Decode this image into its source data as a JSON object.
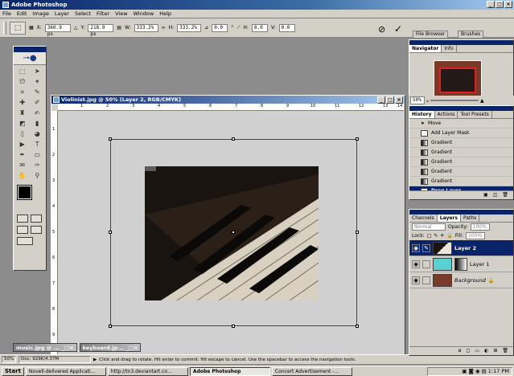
{
  "app": {
    "title": "Adobe Photoshop",
    "window_buttons": [
      "_",
      "□",
      "×"
    ]
  },
  "menu": [
    "File",
    "Edit",
    "Image",
    "Layer",
    "Select",
    "Filter",
    "View",
    "Window",
    "Help"
  ],
  "options_bar": {
    "preset_icon": "transform-icon",
    "x_label": "X:",
    "x_value": "360.9 px",
    "y_label": "Y:",
    "y_value": "218.9 px",
    "w_label": "W:",
    "w_value": "333.2%",
    "h_label": "H:",
    "h_value": "333.2%",
    "angle_value": "0.0",
    "angle_unit": "°",
    "hskew_label": "H:",
    "hskew_value": "0.0",
    "vskew_label": "V:",
    "vskew_value": "0.0",
    "cancel_symbol": "⊘",
    "commit_symbol": "✓"
  },
  "palette_well": {
    "tabs": [
      "File Browser",
      "Brushes"
    ]
  },
  "document": {
    "title": "Violinist.jpg @ 50% (Layer 2, RGB/CMYK)",
    "ruler_h": [
      "1",
      "2",
      "3",
      "4",
      "5",
      "6",
      "7",
      "8",
      "9",
      "10",
      "11",
      "12",
      "13",
      "14"
    ],
    "ruler_v": [
      "1",
      "2",
      "3",
      "4",
      "5",
      "6",
      "7",
      "8",
      "9"
    ],
    "photo_colors": {
      "dark": "#1a1410",
      "key_white": "#ece6d8",
      "key_black": "#0c0a08"
    }
  },
  "mini_docs": [
    {
      "label": "music.jpg @ ...",
      "buttons": "_□×"
    },
    {
      "label": "keyboard.jp...",
      "buttons": "_□×"
    }
  ],
  "status": {
    "zoom": "50%",
    "doc_info": "Doc: 929K/4.37M",
    "hint": "Click and drag to rotate. Hit enter to commit. Hit escape to cancel. Use the spacebar to access the navigation tools."
  },
  "navigator": {
    "tabs": [
      "Navigator",
      "Info"
    ],
    "zoom": "50%"
  },
  "history": {
    "tabs": [
      "History",
      "Actions",
      "Tool Presets"
    ],
    "items": [
      "Move",
      "Add Layer Mask",
      "Gradient",
      "Gradient",
      "Gradient",
      "Gradient",
      "Gradient",
      "Drag Layer"
    ],
    "selected_index": 7
  },
  "layers": {
    "tabs": [
      "Channels",
      "Layers",
      "Paths"
    ],
    "blend_mode": "Normal",
    "opacity_label": "Opacity:",
    "opacity_value": "100%",
    "lock_label": "Lock:",
    "fill_label": "Fill:",
    "fill_value": "100%",
    "items": [
      {
        "name": "Layer 2",
        "selected": true
      },
      {
        "name": "Layer 1",
        "selected": false
      },
      {
        "name": "Background",
        "selected": false
      }
    ]
  },
  "taskbar": {
    "start": "Start",
    "buttons": [
      "Novell-delivered Applicati...",
      "http://tn3.deviantart.co...",
      "Adobe Photoshop",
      "Concert Advertisement -..."
    ],
    "active_index": 2,
    "clock": "1:17 PM"
  },
  "colors": {
    "titlebar": "#0a246a",
    "selection": "#0a246a",
    "chrome": "#d4d0c8",
    "workspace": "#8c8c8c"
  }
}
